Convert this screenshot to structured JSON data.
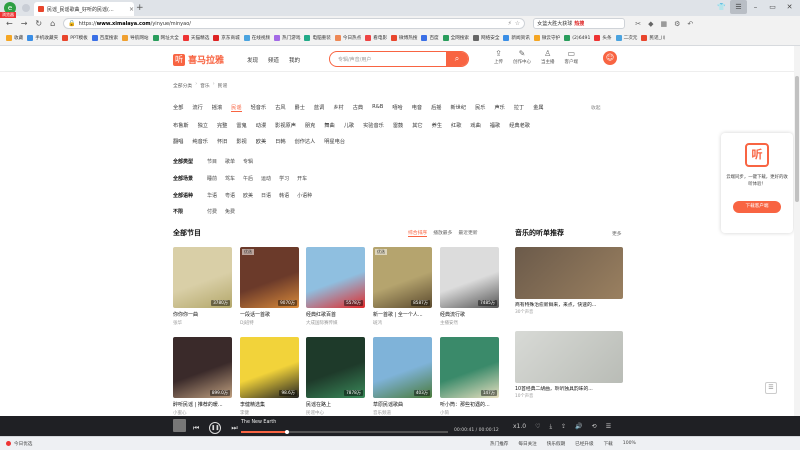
{
  "browser": {
    "badge": "浏览器",
    "tab_title": "民谣_民谣歌曲_好听的民谣(...",
    "url_host": "www.ximalaya.com",
    "url_prefix": "https://",
    "url_path": "/yinyue/minyao/",
    "search_text": "女篮大胜大获球",
    "search_hot": "热搜"
  },
  "bookmarks": [
    {
      "label": "收藏",
      "color": "#f5a623"
    },
    {
      "label": "手机收藏夹",
      "color": "#3a8ee6"
    },
    {
      "label": "PPT模板",
      "color": "#e8452c"
    },
    {
      "label": "百度搜索",
      "color": "#3a6fe6"
    },
    {
      "label": "导航网站",
      "color": "#f0a030"
    },
    {
      "label": "网址大全",
      "color": "#2a9d5c"
    },
    {
      "label": "天猫精选",
      "color": "#e33"
    },
    {
      "label": "京东商城",
      "color": "#d22"
    },
    {
      "label": "在线视频",
      "color": "#4aa3df"
    },
    {
      "label": "热门游戏",
      "color": "#a36ae6"
    },
    {
      "label": "电脑重装",
      "color": "#2a8"
    },
    {
      "label": "今日热点",
      "color": "#e85"
    },
    {
      "label": "看电影",
      "color": "#e44"
    },
    {
      "label": "微博热搜",
      "color": "#e8452c"
    },
    {
      "label": "百度",
      "color": "#3a6fe6"
    },
    {
      "label": "全网搜索",
      "color": "#2a9d5c"
    },
    {
      "label": "网络安全",
      "color": "#666"
    },
    {
      "label": "新闻资讯",
      "color": "#3a8ee6"
    },
    {
      "label": "微云守护",
      "color": "#f5a623"
    },
    {
      "label": "(2)6491",
      "color": "#2a9d5c"
    },
    {
      "label": "头条",
      "color": "#e33"
    },
    {
      "label": "二次元",
      "color": "#4aa3df"
    },
    {
      "label": "民谣_川",
      "color": "#e8452c"
    }
  ],
  "site": {
    "logo_text": "喜马拉雅",
    "nav": [
      "发现",
      "频道",
      "我的"
    ],
    "search_placeholder": "专辑/声音/用户",
    "header_icons": [
      {
        "icon": "upload-icon",
        "glyph": "⇪",
        "label": "上传"
      },
      {
        "icon": "creator-icon",
        "glyph": "✎",
        "label": "创作中心"
      },
      {
        "icon": "anchor-icon",
        "glyph": "♙",
        "label": "当主播"
      },
      {
        "icon": "client-icon",
        "glyph": "▭",
        "label": "客户端"
      }
    ]
  },
  "breadcrumb": [
    "全部分类",
    "音乐",
    "民谣"
  ],
  "genres": [
    "全部",
    "流行",
    "摇滚",
    "民谣",
    "轻音乐",
    "古风",
    "爵士",
    "蓝调",
    "乡村",
    "古典",
    "R&B",
    "嘻哈",
    "电音",
    "后摇",
    "新世纪",
    "民乐",
    "声乐",
    "拉丁",
    "金属"
  ],
  "genres_more": "收起",
  "subgenres": [
    "布鲁斯",
    "独立",
    "完整",
    "雷鬼",
    "动漫",
    "影视原声",
    "朋克",
    "舞曲",
    "儿歌",
    "实验音乐",
    "雷鼓",
    "其它",
    "养生",
    "红歌",
    "戏曲",
    "福歌",
    "经典老歌"
  ],
  "subgenres2": [
    "翻唱",
    "纯音乐",
    "怀旧",
    "影视",
    "欧美",
    "日韩",
    "创作达人",
    "明星电台"
  ],
  "filters": [
    {
      "label": "全部类型",
      "options": [
        "节目",
        "歌单",
        "专辑"
      ]
    },
    {
      "label": "全部场景",
      "options": [
        "睡前",
        "驾车",
        "午后",
        "运动",
        "学习",
        "开车"
      ]
    },
    {
      "label": "全部语种",
      "options": [
        "华语",
        "粤语",
        "欧美",
        "日语",
        "韩语",
        "小语种"
      ]
    },
    {
      "label": "不限",
      "options": [
        "付费",
        "免费"
      ]
    }
  ],
  "section_title": "全部节目",
  "sorts": [
    "综合排序",
    "播放最多",
    "最近更新"
  ],
  "programs": [
    {
      "title": "你你你一曲",
      "author": "张华",
      "plays": "3780万",
      "tag": "",
      "color": "#d9cfa7",
      "accent": "#b3a76a"
    },
    {
      "title": "一段话一首歌",
      "author": "DJ班特",
      "plays": "9070万",
      "tag": "优选",
      "color": "#6b3a2a",
      "accent": "#d98a3a"
    },
    {
      "title": "经典红歌百首",
      "author": "大成国际赛传媒",
      "plays": "5578万",
      "tag": "",
      "color": "#8fbfe0",
      "accent": "#e02b2b"
    },
    {
      "title": "新一首歌 | 全一个人...",
      "author": "斑鸿",
      "plays": "8587万",
      "tag": "优选",
      "color": "#b5a46e",
      "accent": "#5b4a2e"
    },
    {
      "title": "经典流行歌",
      "author": "主播安然",
      "plays": "7485万",
      "tag": "",
      "color": "#dcdcdc",
      "accent": "#555"
    },
    {
      "title": "醉听民谣 | 推荐的暖...",
      "author": "小蜜心",
      "plays": "899.0万",
      "tag": "",
      "color": "#3a2a2a",
      "accent": "#c0a080"
    },
    {
      "title": "李健精选集",
      "author": "李健",
      "plays": "98.6万",
      "tag": "",
      "color": "#f2d33a",
      "accent": "#222"
    },
    {
      "title": "民谣在路上",
      "author": "民谣中心",
      "plays": "7878万",
      "tag": "",
      "color": "#1e3a2a",
      "accent": "#3a8a5a"
    },
    {
      "title": "草原民谣歌曲",
      "author": "音乐频道",
      "plays": "403万",
      "tag": "",
      "color": "#7fb3d9",
      "accent": "#4a7a3a"
    },
    {
      "title": "听小筒：那些初遇的...",
      "author": "小筒",
      "plays": "147万",
      "tag": "",
      "color": "#3a8a6a",
      "accent": "#e8e0c0"
    }
  ],
  "recommend_title": "音乐的听单推荐",
  "recommend_more": "更多",
  "recommends": [
    {
      "title": "商有特殊治愈新鲜来，来点，快速的...",
      "meta": "30个声音",
      "color": "#6b5a4a"
    },
    {
      "title": "10首经典二胡曲，聆听独具韵味的...",
      "meta": "10个声音",
      "color": "#d8dad6"
    }
  ],
  "promo": {
    "logo": "听",
    "text": "云端同步，一键下载，更好的收听体验！",
    "button": "下载客户端"
  },
  "player": {
    "track": "The New Earth",
    "time": "00:00:41 / 00:00:12",
    "progress": 0.22,
    "speed": "x1.0"
  },
  "status": {
    "left": "今日优选",
    "right": [
      "热门推荐",
      "每日关注",
      "快乐假期",
      "已经升级",
      "下载",
      "",
      "100%"
    ]
  }
}
